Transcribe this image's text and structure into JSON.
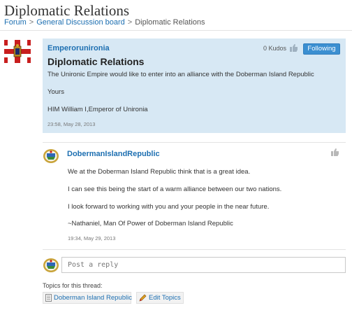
{
  "page": {
    "title": "Diplomatic Relations"
  },
  "breadcrumb": {
    "items": [
      "Forum",
      "General Discussion board",
      "Diplomatic Relations"
    ],
    "separator": ">"
  },
  "post": {
    "author": "Emperorunironia",
    "kudos": "0 Kudos",
    "follow_label": "Following",
    "subject": "Diplomatic Relations",
    "lines": [
      "The Unironic Empire would like to enter into an alliance with the Doberman Island Republic",
      "Yours",
      "HIM William I,Emperor of Unironia"
    ],
    "date": "23:58, May 28, 2013",
    "avatar": "flag-red-white-cross-with-crest"
  },
  "reply": {
    "author": "DobermanIslandRepublic",
    "lines": [
      "We at the Doberman Island Republic think that is a great idea.",
      "I can see this being the start of a warm alliance between our two nations.",
      "I look forward to working with you and your people in the near future.",
      "~Nathaniel, Man Of Power of Doberman Island Republic"
    ],
    "date": "19:34, May 29, 2013",
    "avatar": "island-emblem"
  },
  "compose": {
    "placeholder": "Post a reply"
  },
  "topics": {
    "label": "Topics for this thread:",
    "tags": [
      "Doberman Island Republic"
    ],
    "edit_label": "Edit Topics"
  },
  "colors": {
    "accent": "#1d6fb1",
    "post_background": "#d7e8f4",
    "follow_button": "#3b8fd1"
  }
}
